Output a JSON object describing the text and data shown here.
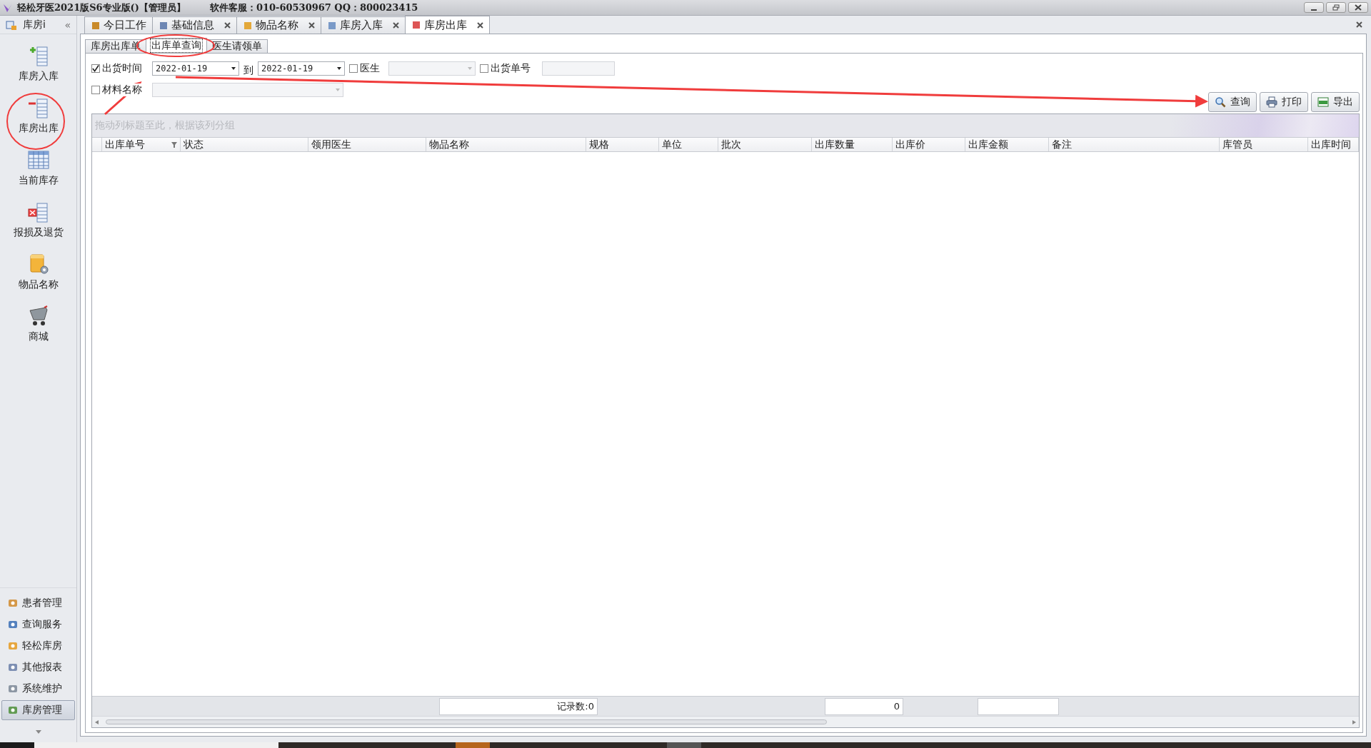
{
  "title_bar": {
    "title": "轻松牙医2021版S6专业版()【管理员】",
    "support": "软件客服：010-60530967 QQ：800023415"
  },
  "sidebar": {
    "header": "库房i",
    "collapse": "«",
    "modules": [
      {
        "label": "库房入库",
        "kind": "add"
      },
      {
        "label": "库房出库",
        "kind": "remove"
      },
      {
        "label": "当前库存",
        "kind": "table"
      },
      {
        "label": "报损及退货",
        "kind": "loss"
      },
      {
        "label": "物品名称",
        "kind": "folder"
      },
      {
        "label": "商城",
        "kind": "cart"
      }
    ],
    "nav": [
      {
        "label": "患者管理",
        "selected": false
      },
      {
        "label": "查询服务",
        "selected": false
      },
      {
        "label": "轻松库房",
        "selected": false
      },
      {
        "label": "其他报表",
        "selected": false
      },
      {
        "label": "系统维护",
        "selected": false
      },
      {
        "label": "库房管理",
        "selected": true
      }
    ]
  },
  "doc_tabs": [
    {
      "label": "今日工作",
      "selected": false,
      "closable": false
    },
    {
      "label": "基础信息",
      "selected": false,
      "closable": true
    },
    {
      "label": "物品名称",
      "selected": false,
      "closable": true
    },
    {
      "label": "库房入库",
      "selected": false,
      "closable": true
    },
    {
      "label": "库房出库",
      "selected": true,
      "closable": true
    }
  ],
  "sub_tabs": [
    {
      "label": "库房出库单",
      "selected": false
    },
    {
      "label": "出库单查询",
      "selected": true
    },
    {
      "label": "医生请领单",
      "selected": false
    }
  ],
  "filters": {
    "ship_time": {
      "label": "出货时间",
      "checked": true,
      "from": "2022-01-19",
      "to_label": "到",
      "to": "2022-01-19"
    },
    "doctor": {
      "label": "医生",
      "checked": false
    },
    "ship_number": {
      "label": "出货单号",
      "checked": false
    },
    "material": {
      "label": "材料名称",
      "checked": false
    }
  },
  "buttons": [
    {
      "label": "查询",
      "kind": "search"
    },
    {
      "label": "打印",
      "kind": "print"
    },
    {
      "label": "导出",
      "kind": "xls"
    }
  ],
  "grid": {
    "group_hint": "拖动列标题至此，根据该列分组",
    "columns": [
      "出库单号",
      "状态",
      "领用医生",
      "物品名称",
      "规格",
      "单位",
      "批次",
      "出库数量",
      "出库价",
      "出库金额",
      "备注",
      "库管员",
      "出库时间"
    ],
    "footer": {
      "record_count": "记录数:0",
      "quantity_total": "0"
    }
  }
}
